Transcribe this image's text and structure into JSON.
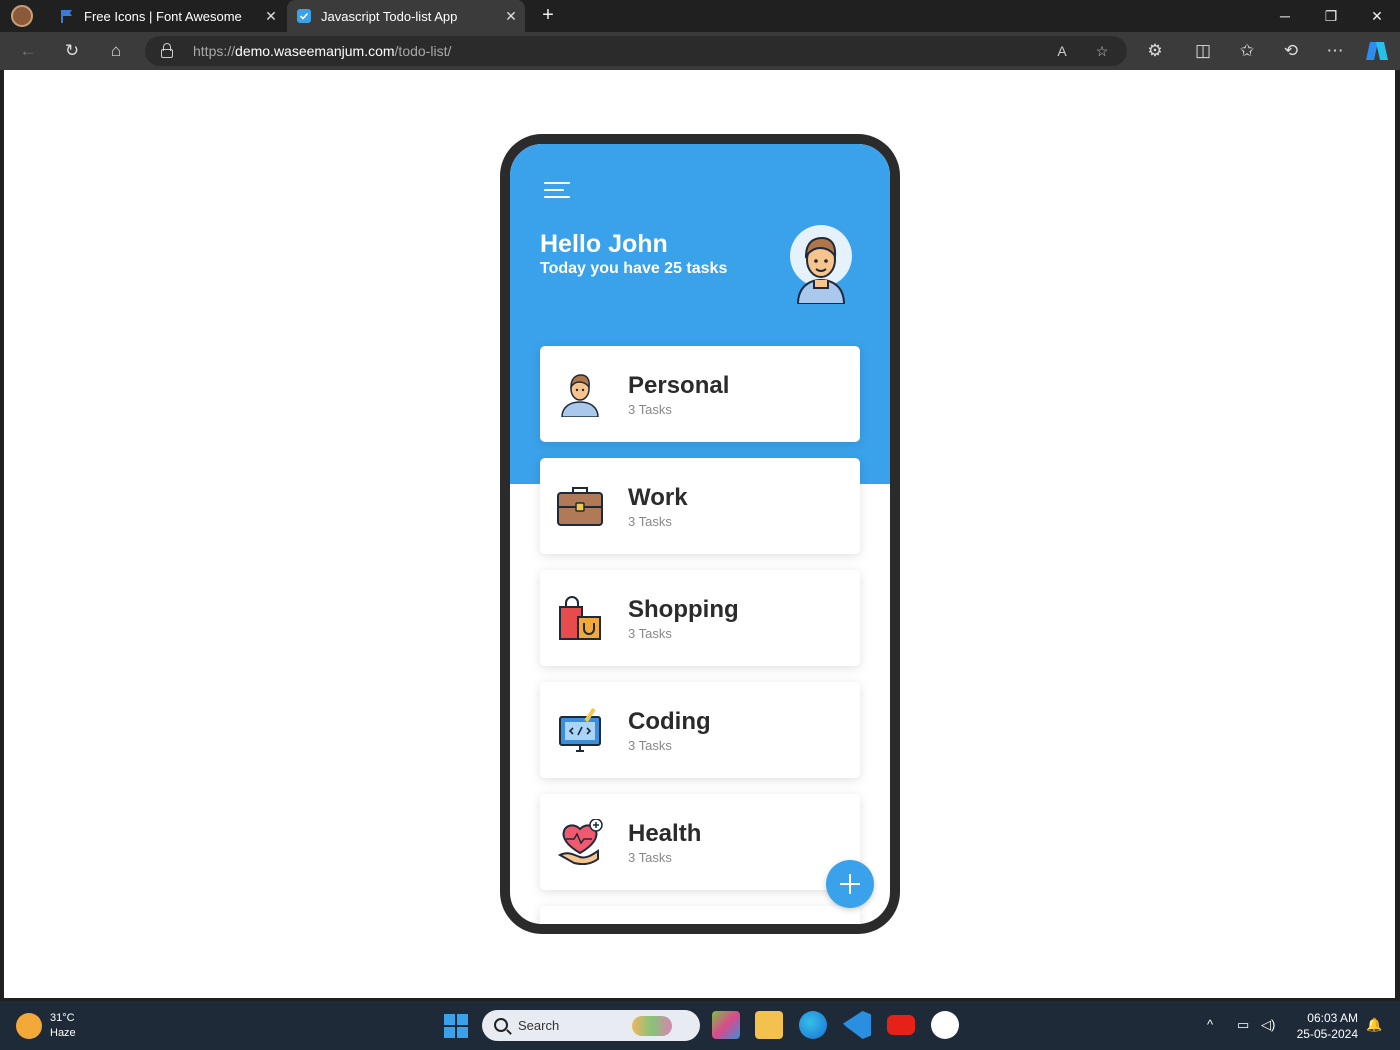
{
  "browser": {
    "tabs": [
      {
        "title": "Free Icons | Font Awesome",
        "active": false
      },
      {
        "title": "Javascript Todo-list App",
        "active": true
      }
    ],
    "address": {
      "scheme": "https://",
      "host": "demo.waseemanjum.com",
      "path": "/todo-list/"
    }
  },
  "app": {
    "greeting": "Hello John",
    "subtitle": "Today you have 25 tasks",
    "accent_color": "#3aa2ea",
    "categories": [
      {
        "name": "Personal",
        "count": "3 Tasks",
        "icon": "person-icon"
      },
      {
        "name": "Work",
        "count": "3 Tasks",
        "icon": "briefcase-icon"
      },
      {
        "name": "Shopping",
        "count": "3 Tasks",
        "icon": "shopping-bags-icon"
      },
      {
        "name": "Coding",
        "count": "3 Tasks",
        "icon": "coding-monitor-icon"
      },
      {
        "name": "Health",
        "count": "3 Tasks",
        "icon": "health-heart-icon"
      }
    ]
  },
  "taskbar": {
    "weather": {
      "temp": "31°C",
      "condition": "Haze"
    },
    "search_placeholder": "Search",
    "time": "06:03 AM",
    "date": "25-05-2024"
  }
}
